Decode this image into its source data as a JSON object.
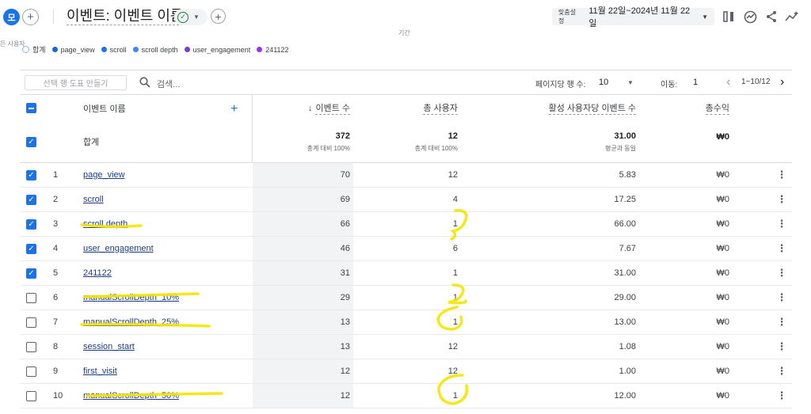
{
  "topbar": {
    "segment_badge": "모",
    "plus_glyph": "+",
    "title": "이벤트: 이벤트 이름",
    "check_glyph": "✓",
    "date_label": "맞춤설정",
    "date_value": "11월 22일~2024년 11월 22일",
    "subtext": "기간"
  },
  "user_hint": "든 사용자",
  "legend": [
    {
      "label": "합계",
      "color": "#8ab4f8",
      "ring": true
    },
    {
      "label": "page_view",
      "color": "#1967d2"
    },
    {
      "label": "scroll",
      "color": "#1a73e8"
    },
    {
      "label": "scroll depth",
      "color": "#4285f4"
    },
    {
      "label": "user_engagement",
      "color": "#7b3fc6"
    },
    {
      "label": "241122",
      "color": "#9334e6"
    }
  ],
  "toolbar": {
    "new_segment": "선택 행 도표 만들기",
    "search_placeholder": "검색...",
    "rows_per_page_label": "페이지당 행 수:",
    "rows_per_page_value": "10",
    "goto_label": "이동:",
    "goto_value": "1",
    "page_range": "1~10/12"
  },
  "headers": {
    "name": "이벤트 이름",
    "m1": "이벤트 수",
    "m2": "총 사용자",
    "m3": "활성 사용자당 이벤트 수",
    "m4": "총수익"
  },
  "totals": {
    "label": "합계",
    "m1": "372",
    "m1_sub": "총계 대비 100%",
    "m2": "12",
    "m2_sub": "총계 대비 100%",
    "m3": "31.00",
    "m3_sub": "평균과 동일",
    "m4": "₩0"
  },
  "rows": [
    {
      "idx": "1",
      "name": "page_view",
      "m1": "70",
      "m2": "12",
      "m3": "5.83",
      "m4": "₩0",
      "checked": true
    },
    {
      "idx": "2",
      "name": "scroll",
      "m1": "69",
      "m2": "4",
      "m3": "17.25",
      "m4": "₩0",
      "checked": true
    },
    {
      "idx": "3",
      "name": "scroll depth",
      "m1": "66",
      "m2": "1",
      "m3": "66.00",
      "m4": "₩0",
      "checked": true
    },
    {
      "idx": "4",
      "name": "user_engagement",
      "m1": "46",
      "m2": "6",
      "m3": "7.67",
      "m4": "₩0",
      "checked": true
    },
    {
      "idx": "5",
      "name": "241122",
      "m1": "31",
      "m2": "1",
      "m3": "31.00",
      "m4": "₩0",
      "checked": true
    },
    {
      "idx": "6",
      "name": "manualScrollDepth_10%",
      "m1": "29",
      "m2": "1",
      "m3": "29.00",
      "m4": "₩0",
      "checked": false
    },
    {
      "idx": "7",
      "name": "manualScrollDepth_25%",
      "m1": "13",
      "m2": "1",
      "m3": "13.00",
      "m4": "₩0",
      "checked": false
    },
    {
      "idx": "8",
      "name": "session_start",
      "m1": "13",
      "m2": "12",
      "m3": "1.08",
      "m4": "₩0",
      "checked": false
    },
    {
      "idx": "9",
      "name": "first_visit",
      "m1": "12",
      "m2": "12",
      "m3": "1.00",
      "m4": "₩0",
      "checked": false
    },
    {
      "idx": "10",
      "name": "manualScrollDepth_50%",
      "m1": "12",
      "m2": "1",
      "m3": "12.00",
      "m4": "₩0",
      "checked": false
    }
  ],
  "row_menu_glyph": "⋮",
  "highlight_color": "#f5e600"
}
